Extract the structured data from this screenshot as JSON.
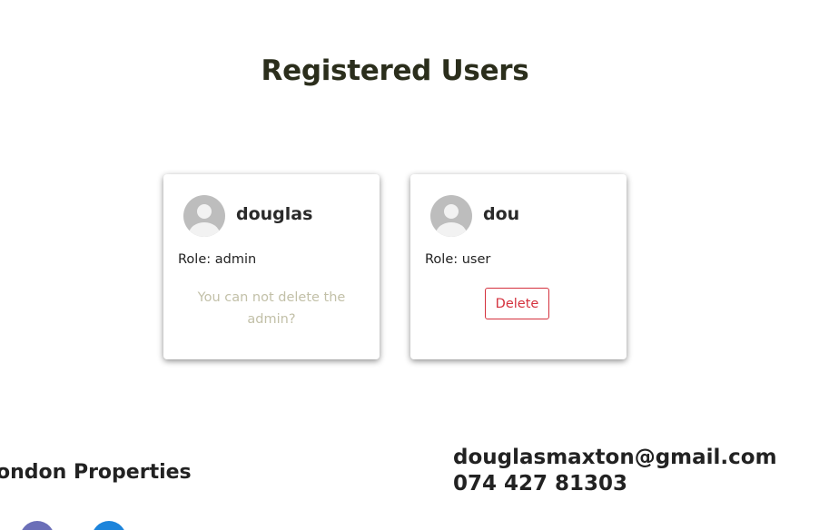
{
  "page": {
    "title": "Registered Users"
  },
  "users": [
    {
      "username": "douglas",
      "role_text": "Role: admin",
      "note": "You can not delete the admin?"
    },
    {
      "username": "dou",
      "role_text": "Role: user",
      "delete_label": "Delete"
    }
  ],
  "footer": {
    "brand": "ondon Properties",
    "email": "douglasmaxton@gmail.com",
    "phone": "074 427 81303",
    "social_icons": [
      "social-icon",
      "social-icon"
    ]
  },
  "colors": {
    "title": "#2b2e1c",
    "delete": "#d4313d",
    "note": "#c2c0a8",
    "avatar": "#bdbdbd",
    "social_1": "#6b6fb8",
    "social_2": "#1c84db"
  }
}
